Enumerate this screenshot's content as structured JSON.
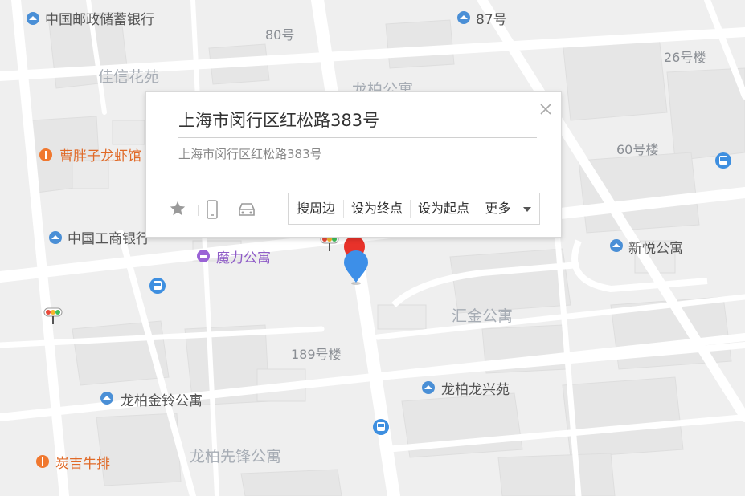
{
  "popup": {
    "title": "上海市闵行区红松路383号",
    "address": "上海市闵行区红松路383号",
    "actions": [
      "搜周边",
      "设为终点",
      "设为起点",
      "更多"
    ]
  },
  "labels": {
    "postal_bank": "中国邮政储蓄银行",
    "no80": "80号",
    "no87": "87号",
    "no26": "26号楼",
    "jiaxin": "佳信花苑",
    "longbai_top": "龙柏公寓",
    "caopangzi": "曹胖子龙虾馆",
    "no60": "60号楼",
    "icbc": "中国工商银行",
    "moli": "魔力公寓",
    "xinyue": "新悦公寓",
    "huijin": "汇金公寓",
    "no189": "189号楼",
    "longbai_longxing": "龙柏龙兴苑",
    "longbai_jinling": "龙柏金铃公寓",
    "longbai_xianfeng": "龙柏先锋公寓",
    "tanji": "炭吉牛排"
  },
  "colors": {
    "poi_blue": "#4a8fd6",
    "food_orange": "#f0782f",
    "hotel_purple": "#9a63d6",
    "bus_blue": "#3e8fe0",
    "marker_blue": "#3d8fe8",
    "marker_red": "#e8322a"
  },
  "icons": [
    "poi-pin-icon",
    "food-icon",
    "hotel-icon",
    "bus-stop-icon",
    "traffic-light-icon",
    "star-icon",
    "phone-icon",
    "car-icon",
    "close-icon",
    "caret-down-icon",
    "location-marker-icon"
  ]
}
